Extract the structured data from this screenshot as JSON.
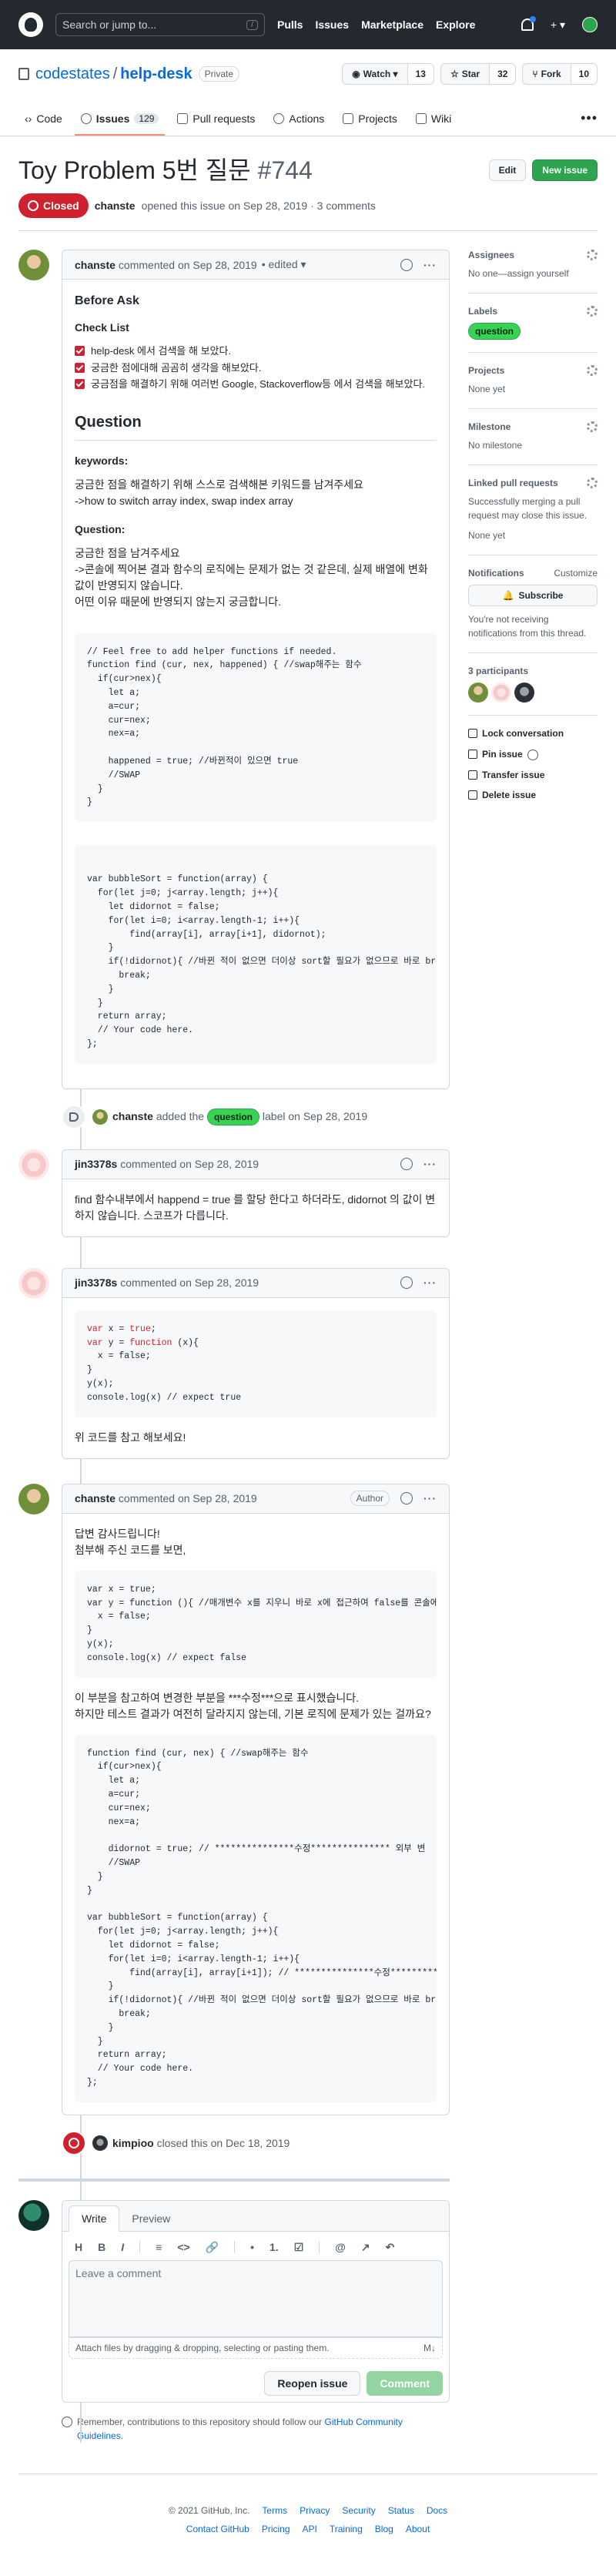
{
  "header": {
    "search_placeholder": "Search or jump to...",
    "slash": "/",
    "nav": [
      "Pulls",
      "Issues",
      "Marketplace",
      "Explore"
    ],
    "plus": "+ ▾"
  },
  "repo": {
    "owner": "codestates",
    "name": "help-desk",
    "visibility": "Private",
    "watch_label": "Watch ▾",
    "watch_count": "13",
    "star_label": "Star",
    "star_count": "32",
    "fork_label": "Fork",
    "fork_count": "10",
    "tabs": [
      {
        "label": "Code"
      },
      {
        "label": "Issues",
        "count": "129"
      },
      {
        "label": "Pull requests"
      },
      {
        "label": "Actions"
      },
      {
        "label": "Projects"
      },
      {
        "label": "Wiki"
      }
    ],
    "more": "•••"
  },
  "issue": {
    "title": "Toy Problem 5번 질문",
    "number": "#744",
    "edit_label": "Edit",
    "new_issue_label": "New issue",
    "state": "Closed",
    "author": "chanste",
    "opened_text": "opened this issue on Sep 28, 2019 · 3 comments"
  },
  "comments": [
    {
      "author": "chanste",
      "meta": "commented on Sep 28, 2019",
      "edited": "• edited ▾",
      "before_ask": "Before Ask",
      "check_list": "Check List",
      "checks": [
        "help-desk 에서 검색을 해 보았다.",
        "궁금한 점에대해 곰곰히 생각을 해보았다.",
        "궁금점을 해결하기 위해 여러번 Google, Stackoverflow등 에서 검색을 해보았다."
      ],
      "question_heading": "Question",
      "keywords_heading": "keywords:",
      "keywords_text1": "궁금한 점을 해결하기 위해 스스로 검색해본 키워드를 남겨주세요",
      "keywords_text2": "->how to switch array index, swap index array",
      "question_sub": "Question:",
      "q_text1": "궁금한 점을 남겨주세요",
      "q_text2": "->콘솔에 찍어본 결과 함수의 로직에는 문제가 없는 것 같은데, 실제 배열에 변화값이 반영되지 않습니다.",
      "q_text3": "어떤 이유 때문에 반영되지 않는지 궁금합니다.",
      "code1": "// Feel free to add helper functions if needed.\nfunction find (cur, nex, happened) { //swap해주는 함수\n  if(cur>nex){\n    let a;\n    a=cur;\n    cur=nex;\n    nex=a;\n\n    happened = true; //바뀐적이 있으면 true\n    //SWAP\n  }\n}",
      "code2": "var bubbleSort = function(array) {\n  for(let j=0; j<array.length; j++){\n    let didornot = false;\n    for(let i=0; i<array.length-1; i++){\n        find(array[i], array[i+1], didornot);\n    }\n    if(!didornot){ //바뀐 적이 없으면 더이상 sort할 필요가 없으므로 바로 break\n      break;\n    }\n  }\n  return array;\n  // Your code here.\n};"
    },
    {
      "author": "jin3378s",
      "meta": "commented on Sep 28, 2019",
      "body": "find 함수내부에서 happend = true 를 할당 한다고 하더라도, didornot 의 값이 변하지 않습니다. 스코프가 다릅니다."
    },
    {
      "author": "jin3378s",
      "meta": "commented on Sep 28, 2019",
      "code_lines": [
        {
          "k": "var",
          "rest": " x = ",
          "v": "true",
          "end": ";"
        },
        {
          "k": "var",
          "rest": " y = ",
          "v": "function",
          "end": " (x){"
        }
      ],
      "code_tail": "  x = false;\n}\ny(x);\nconsole.log(x) // expect true",
      "body": "위 코드를 참고 해보세요!"
    },
    {
      "author": "chanste",
      "meta": "commented on Sep 28, 2019",
      "author_badge": "Author",
      "intro1": "답변 감사드립니다!",
      "intro2": "첨부해 주신 코드를 보면,",
      "code1": "var x = true;\nvar y = function (){ //매개변수 x를 지우니 바로 x에 접근하여 false를 콘솔에\n  x = false;\n}\ny(x);\nconsole.log(x) // expect false",
      "mid1": "이 부분을 참고하여 변경한 부분을 ***수정***으로 표시했습니다.",
      "mid2": "하지만 테스트 결과가 여전히 달라지지 않는데, 기본 로직에 문제가 있는 걸까요?",
      "code2": "function find (cur, nex) { //swap해주는 함수\n  if(cur>nex){\n    let a;\n    a=cur;\n    cur=nex;\n    nex=a;\n\n    didornot = true; // ***************수정*************** 외부 변\n    //SWAP\n  }\n}\n\nvar bubbleSort = function(array) {\n  for(let j=0; j<array.length; j++){\n    let didornot = false;\n    for(let i=0; i<array.length-1; i++){\n        find(array[i], array[i+1]); // ***************수정*********\n    }\n    if(!didornot){ //바뀐 적이 없으면 더이상 sort할 필요가 없으므로 바로 br\n      break;\n    }\n  }\n  return array;\n  // Your code here.\n};"
    }
  ],
  "events": {
    "label_event": {
      "actor": "chanste",
      "pre": "added the",
      "label": "question",
      "post": "label on Sep 28, 2019"
    },
    "closed_event": {
      "actor": "kimpioo",
      "text": "closed this on Dec 18, 2019"
    }
  },
  "composer": {
    "tab_write": "Write",
    "tab_preview": "Preview",
    "tools": [
      "H",
      "B",
      "I",
      "≡",
      "<>",
      "🔗",
      "•",
      "1.",
      "☑",
      "@",
      "↗",
      "↶"
    ],
    "placeholder": "Leave a comment",
    "attach_text": "Attach files by dragging & dropping, selecting or pasting them.",
    "md": "M↓",
    "reopen_label": "Reopen issue",
    "comment_label": "Comment",
    "note_pre": "Remember, contributions to this repository should follow our",
    "note_link": "GitHub Community Guidelines",
    "note_end": "."
  },
  "sidebar": {
    "assignees_title": "Assignees",
    "assignees_text": "No one—assign yourself",
    "labels_title": "Labels",
    "label": "question",
    "projects_title": "Projects",
    "projects_text": "None yet",
    "milestone_title": "Milestone",
    "milestone_text": "No milestone",
    "linked_title": "Linked pull requests",
    "linked_text": "Successfully merging a pull request may close this issue.",
    "linked_none": "None yet",
    "notif_title": "Notifications",
    "notif_customize": "Customize",
    "subscribe_label": "Subscribe",
    "notif_text": "You're not receiving notifications from this thread.",
    "participants_title": "3 participants",
    "actions": [
      "Lock conversation",
      "Pin issue",
      "Transfer issue",
      "Delete issue"
    ]
  },
  "footer": {
    "row1": [
      "© 2021 GitHub, Inc.",
      "Terms",
      "Privacy",
      "Security",
      "Status",
      "Docs"
    ],
    "row2": [
      "Contact GitHub",
      "Pricing",
      "API",
      "Training",
      "Blog",
      "About"
    ]
  }
}
